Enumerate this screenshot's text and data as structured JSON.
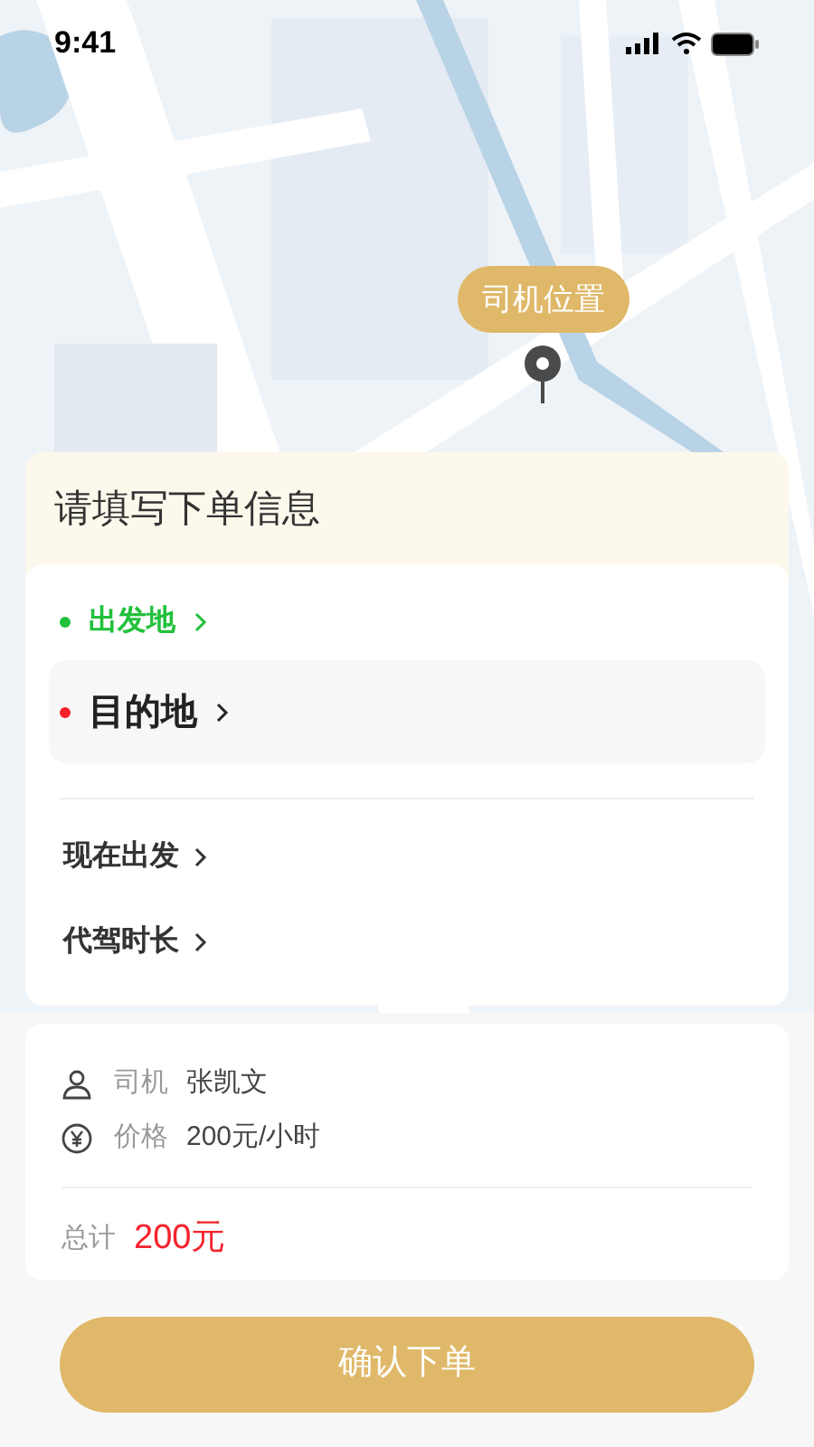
{
  "status_bar": {
    "time": "9:41"
  },
  "map": {
    "kind": "picture",
    "marker_label": "司机位置"
  },
  "order_form": {
    "title": "请填写下单信息",
    "locations": [
      {
        "label": "出发地",
        "kind": "origin",
        "color": "#22c03c",
        "selected": false
      },
      {
        "label": "目的地",
        "kind": "destination",
        "color": "#f5222d",
        "selected": true
      }
    ],
    "options": [
      {
        "label": "现在出发"
      },
      {
        "label": "代驾时长"
      }
    ]
  },
  "summary": {
    "rows": [
      {
        "kind": "driver",
        "label": "司机",
        "value": "张凯文"
      },
      {
        "kind": "price",
        "label": "价格",
        "value": "200元/小时"
      }
    ],
    "total_label": "总计",
    "total_value": "200元"
  },
  "confirm_button": "确认下单"
}
